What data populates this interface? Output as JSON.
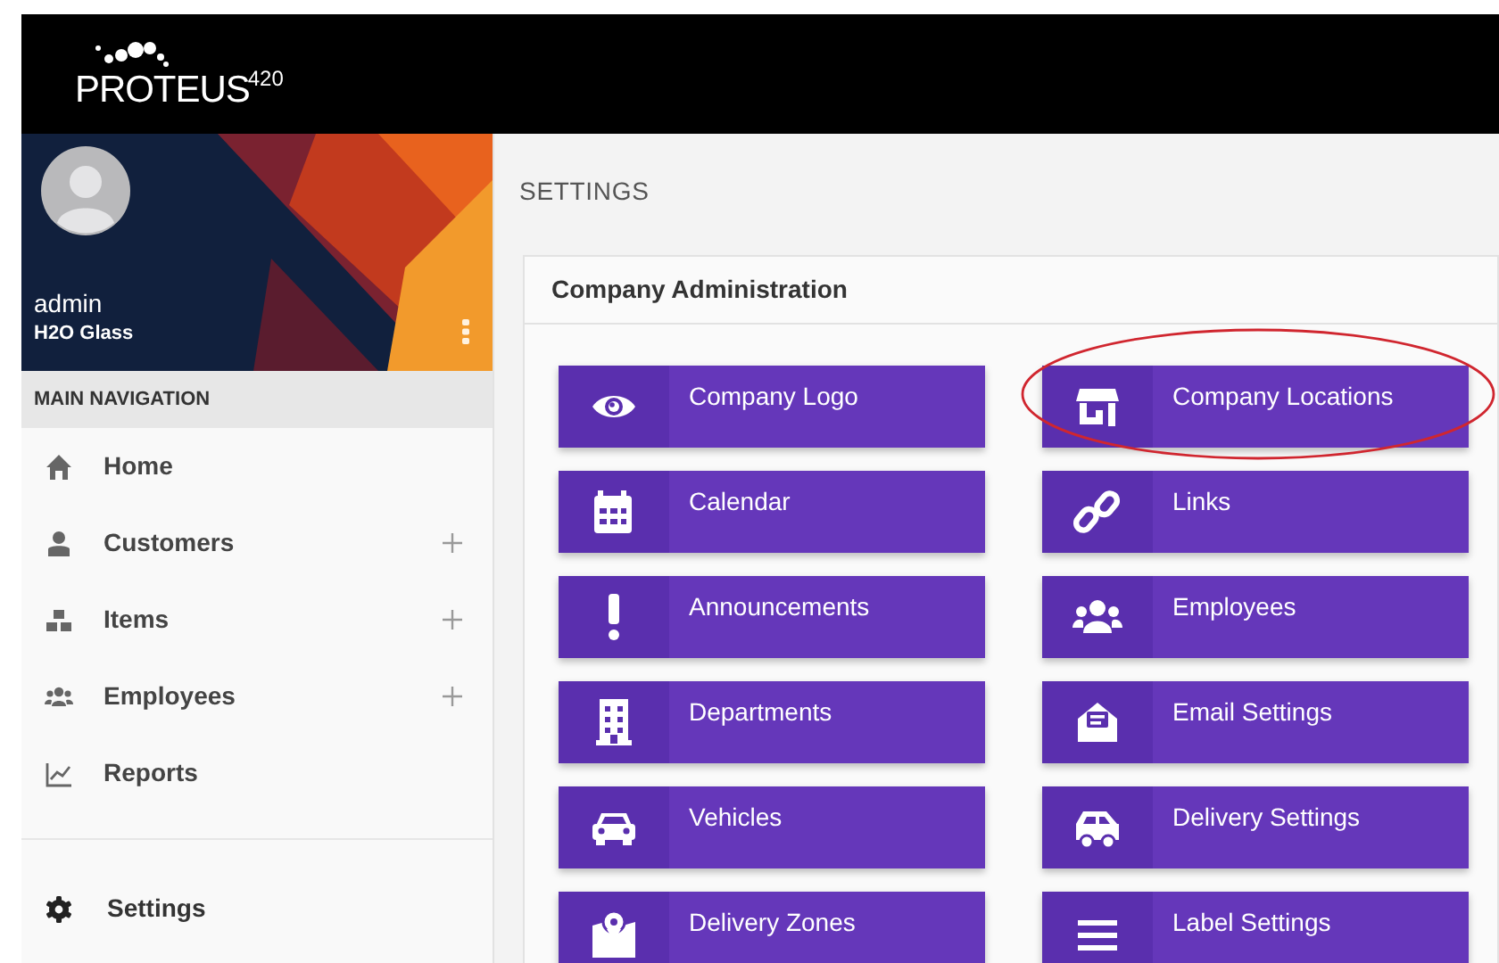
{
  "logo": {
    "name": "PROTEUS",
    "suffix": "420"
  },
  "profile": {
    "user": "admin",
    "company": "H2O Glass"
  },
  "sidebar": {
    "heading": "MAIN NAVIGATION",
    "items": [
      {
        "label": "Home",
        "expandable": false
      },
      {
        "label": "Customers",
        "expandable": true
      },
      {
        "label": "Items",
        "expandable": true
      },
      {
        "label": "Employees",
        "expandable": true
      },
      {
        "label": "Reports",
        "expandable": false
      }
    ],
    "footer_item": {
      "label": "Settings"
    }
  },
  "page_title": "SETTINGS",
  "card": {
    "title": "Company Administration",
    "tiles": [
      {
        "label": "Company Logo",
        "highlighted": false
      },
      {
        "label": "Company Locations",
        "highlighted": true
      },
      {
        "label": "Calendar",
        "highlighted": false
      },
      {
        "label": "Links",
        "highlighted": false
      },
      {
        "label": "Announcements",
        "highlighted": false
      },
      {
        "label": "Employees",
        "highlighted": false
      },
      {
        "label": "Departments",
        "highlighted": false
      },
      {
        "label": "Email Settings",
        "highlighted": false
      },
      {
        "label": "Vehicles",
        "highlighted": false
      },
      {
        "label": "Delivery Settings",
        "highlighted": false
      },
      {
        "label": "Delivery Zones",
        "highlighted": false
      },
      {
        "label": "Label Settings",
        "highlighted": false
      }
    ]
  }
}
